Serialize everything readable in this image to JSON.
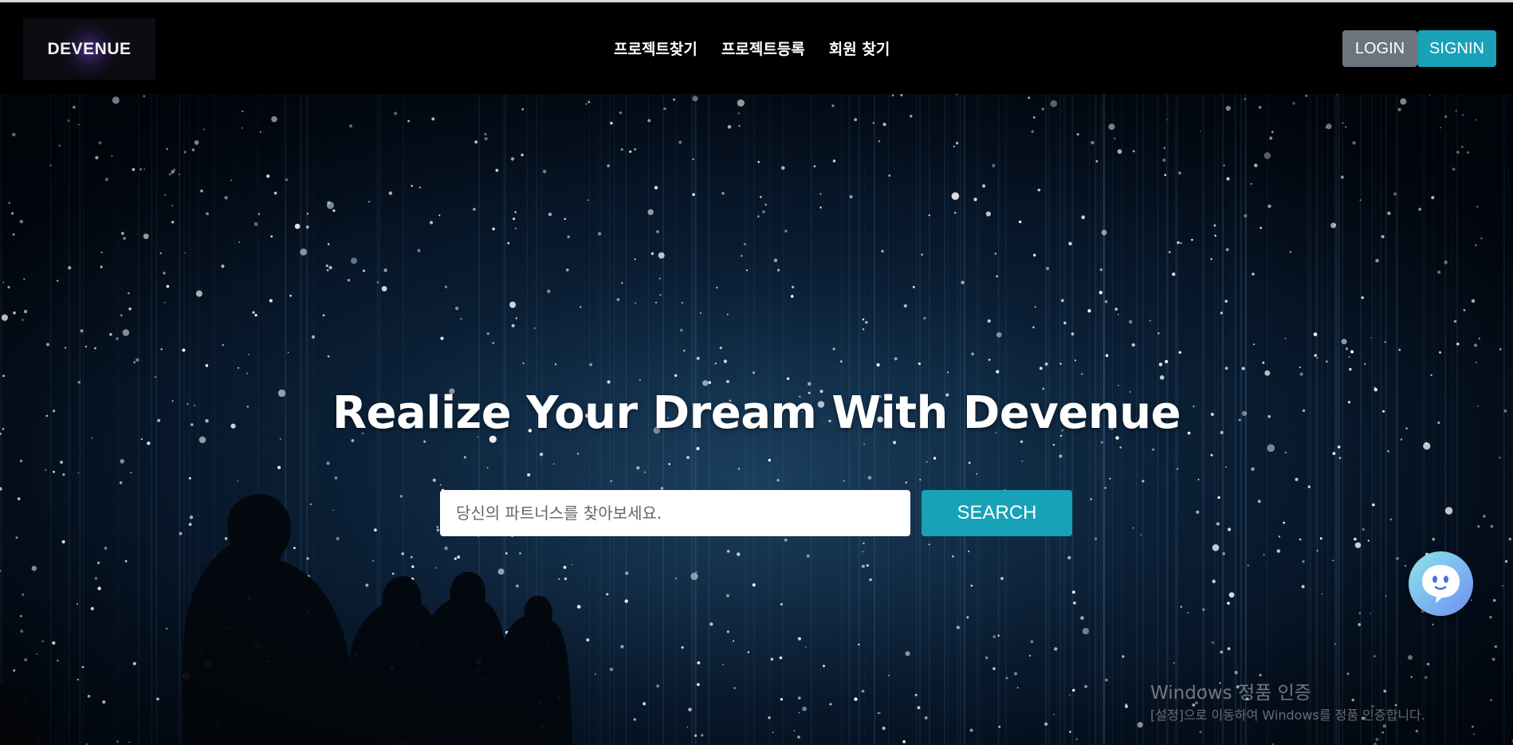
{
  "brand": {
    "logo_text": "DEVENUE"
  },
  "nav": {
    "items": [
      {
        "label": "프로젝트찾기"
      },
      {
        "label": "프로젝트등록"
      },
      {
        "label": "회원 찾기"
      }
    ],
    "login_label": "LOGIN",
    "signin_label": "SIGNIN"
  },
  "hero": {
    "title": "Realize Your Dream With Devenue",
    "search_placeholder": "당신의 파트너스를 찾아보세요.",
    "search_value": "",
    "search_button_label": "SEARCH"
  },
  "windows_watermark": {
    "title": "Windows 정품 인증",
    "subtitle": "[설정]으로 이동하여 Windows를 정품 인증합니다."
  },
  "chat_widget": {
    "icon": "chat-bubble-face-icon"
  },
  "colors": {
    "accent": "#17a2b8",
    "secondary": "#6c757d",
    "navbar_bg": "#000000",
    "hero_bg": "#0b2236"
  }
}
